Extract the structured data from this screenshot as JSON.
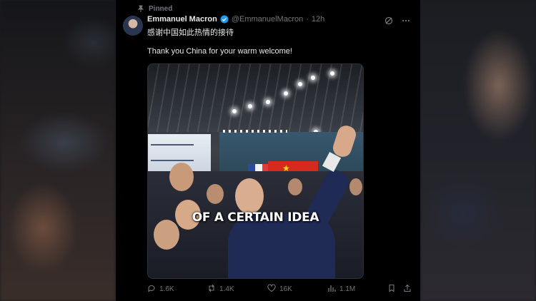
{
  "pinned_label": "Pinned",
  "author": {
    "name": "Emmanuel Macron",
    "handle": "@EmmanuelMacron",
    "separator": "·",
    "time": "12h"
  },
  "tweet": {
    "text_cn": "感谢中国如此热情的接待",
    "text_en": "Thank you China for your warm welcome!"
  },
  "media": {
    "overlay_caption": "OF A CERTAIN IDEA"
  },
  "stats": {
    "replies": "1.6K",
    "reposts": "1.4K",
    "likes": "16K",
    "views": "1.1M"
  },
  "colors": {
    "background": "#000000",
    "text_primary": "#e7e9ea",
    "text_secondary": "#71767b",
    "verified": "#1d9bf0"
  },
  "icons": {
    "pin": "pin-icon",
    "verified": "verified-badge-icon",
    "grok": "grok-icon",
    "more": "more-icon",
    "reply": "reply-icon",
    "repost": "repost-icon",
    "like": "heart-icon",
    "views": "views-icon",
    "bookmark": "bookmark-icon",
    "share": "share-icon"
  }
}
